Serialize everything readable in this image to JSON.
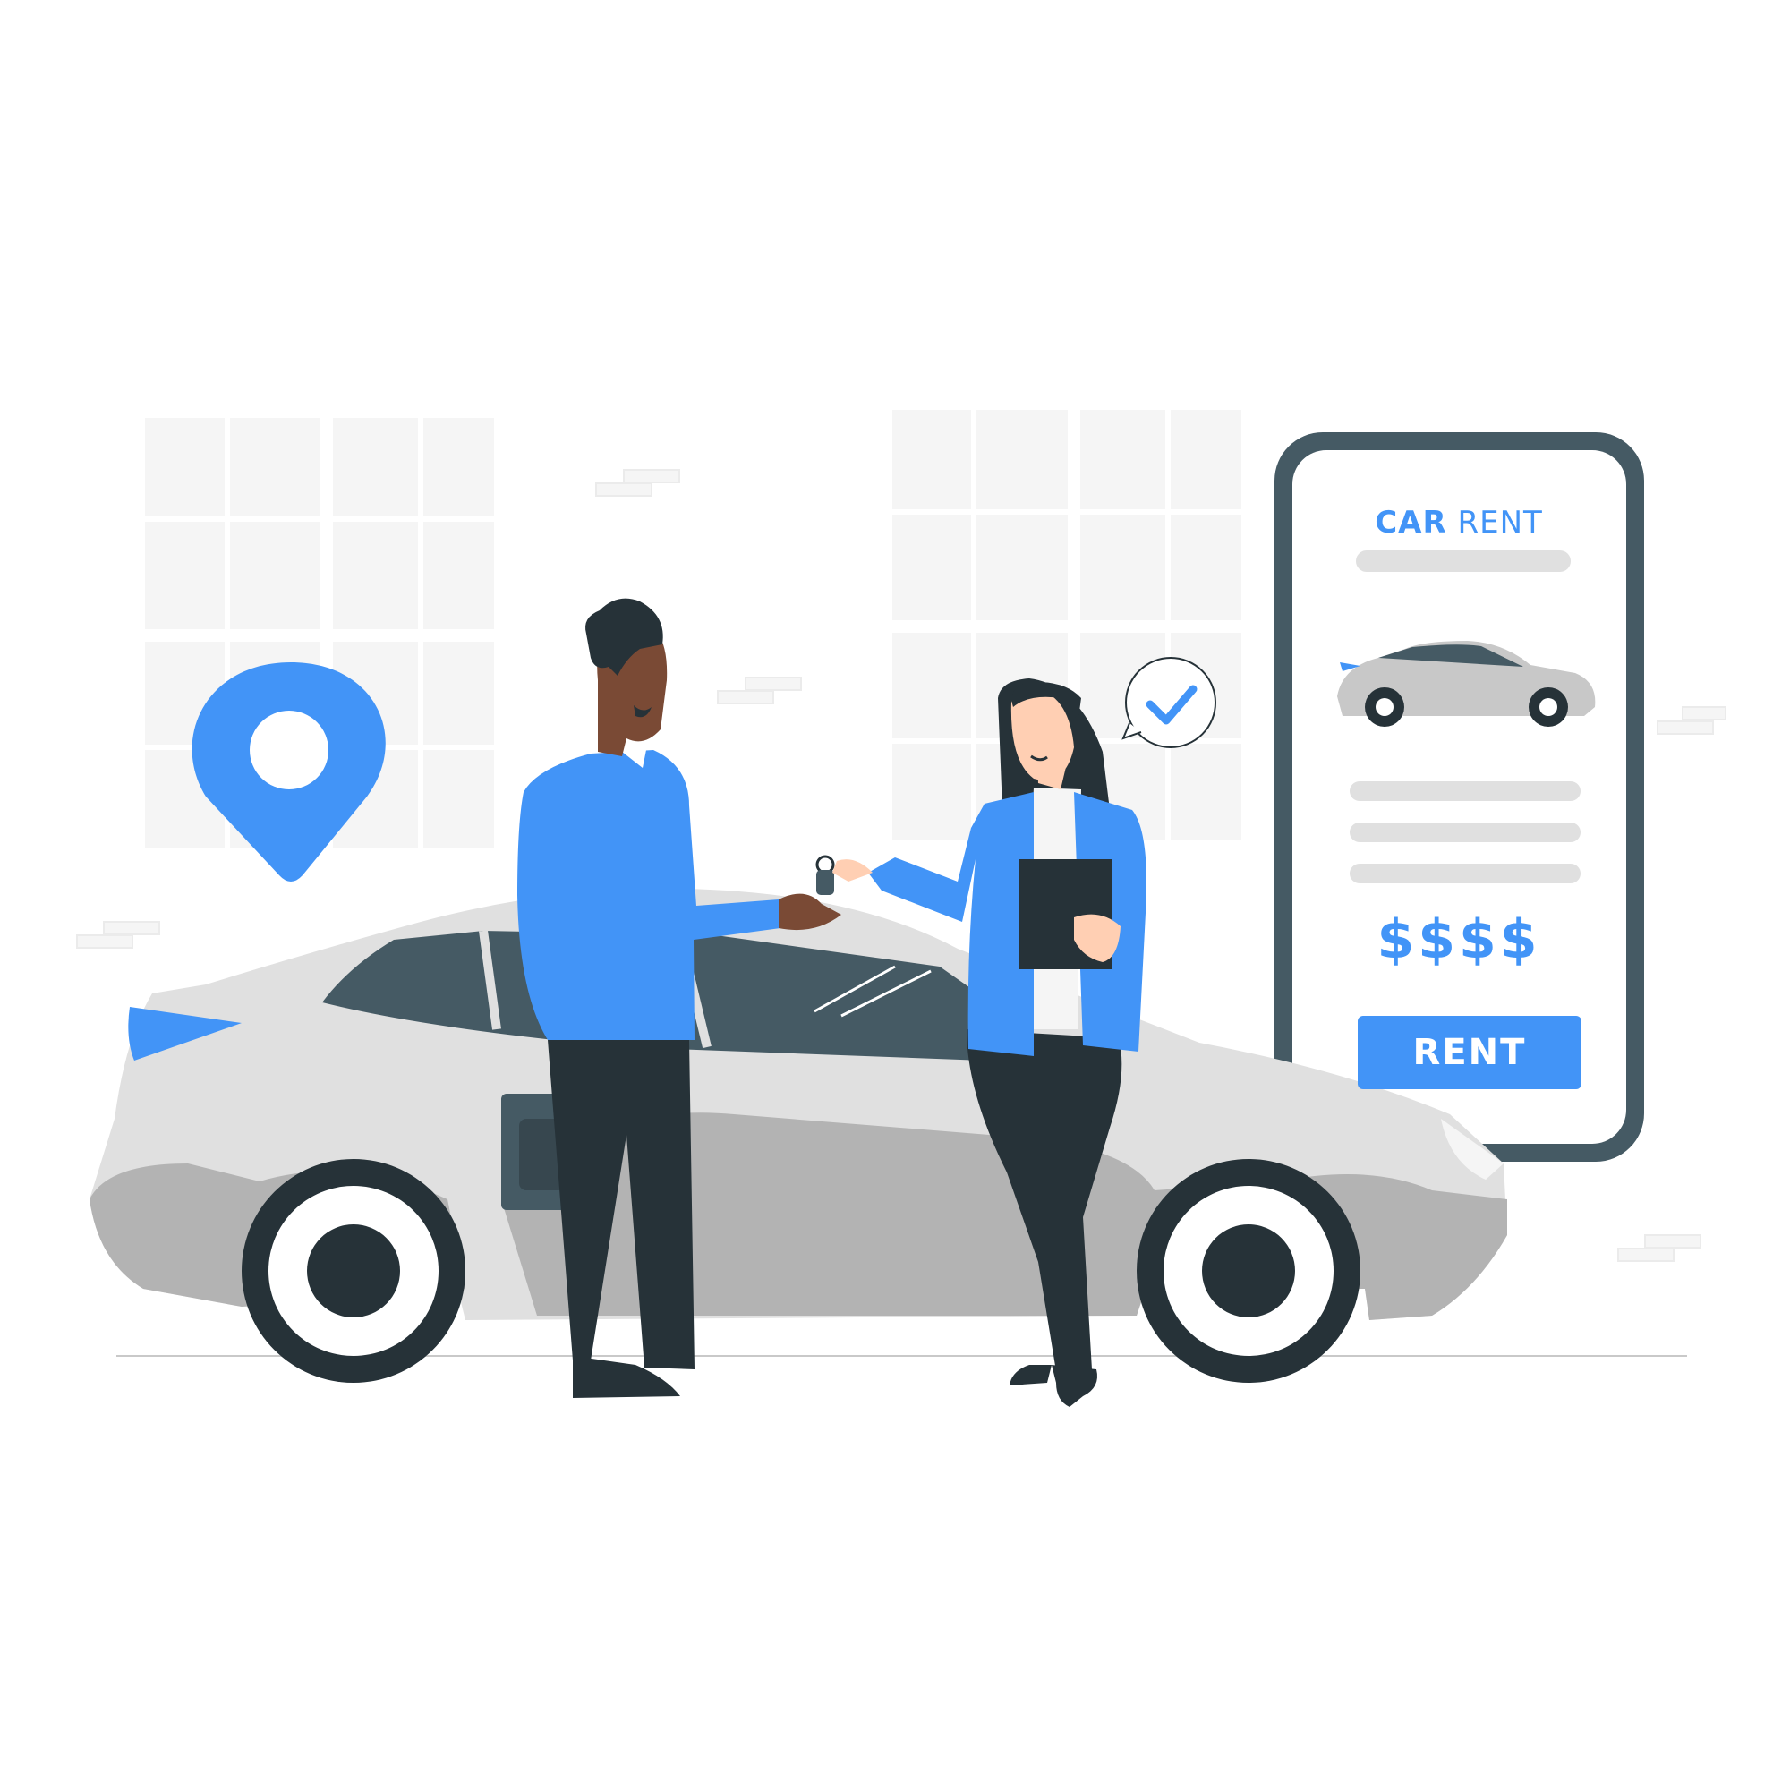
{
  "phone": {
    "title_bold": "CAR",
    "title_rest": "RENT",
    "price": "$$$$",
    "rent_button_label": "RENT"
  },
  "colors": {
    "accent": "#4294f7",
    "dark": "#263238",
    "slate": "#455a64",
    "car_light": "#e0e0e0",
    "car_mid": "#b3b3b3",
    "window_fill": "#f5f5f5"
  },
  "icons": [
    "location-pin-icon",
    "checkmark-icon",
    "car-key-icon"
  ]
}
